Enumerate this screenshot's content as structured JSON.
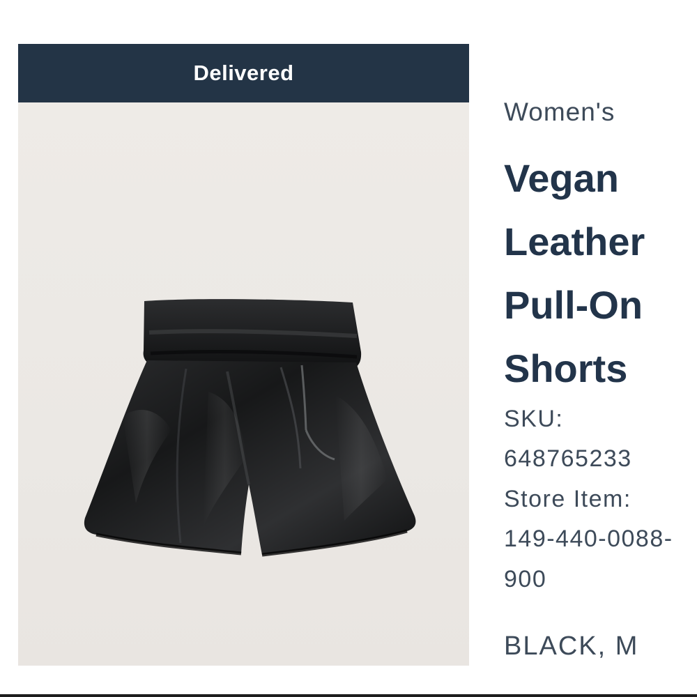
{
  "order_item": {
    "status": "Delivered",
    "category": "Women's",
    "title_lines": [
      "Vegan",
      "Leather",
      "Pull-On",
      "Shorts"
    ],
    "sku_label": "SKU:",
    "sku_value": "648765233",
    "store_item_label": "Store Item:",
    "store_item_value_line1": "149-440-0088-",
    "store_item_value_line2": "900",
    "variant": "BLACK, M",
    "image_icon": "black-vegan-leather-shorts-image"
  },
  "colors": {
    "status_banner": "#233446",
    "title_text": "#22344a",
    "meta_text": "#3d4a59",
    "image_background": "#ece9e5"
  }
}
